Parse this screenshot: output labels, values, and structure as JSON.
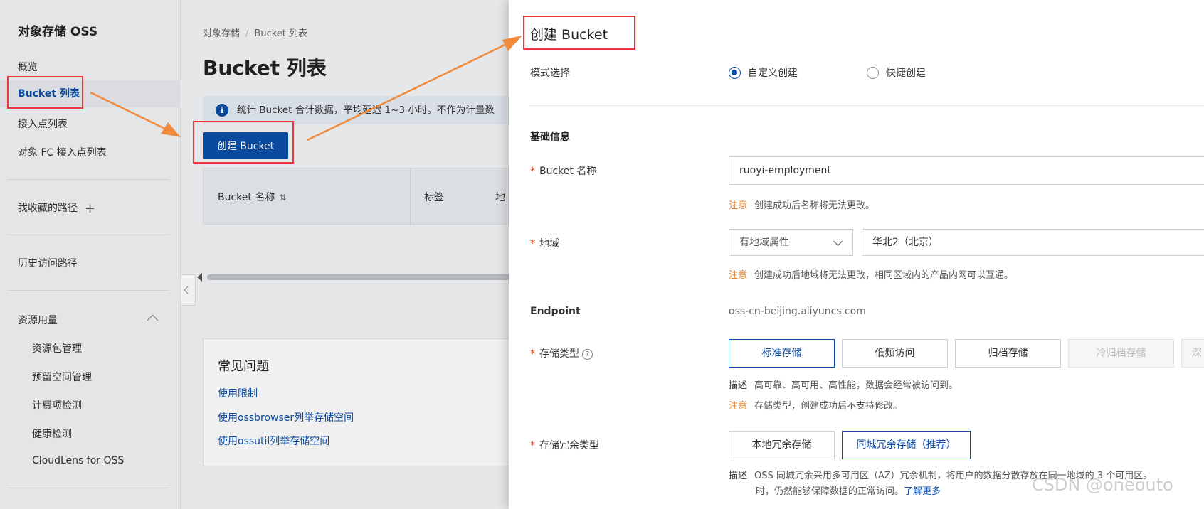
{
  "sidebar": {
    "title": "对象存储 OSS",
    "items": [
      {
        "label": "概览"
      },
      {
        "label": "Bucket 列表"
      },
      {
        "label": "接入点列表"
      },
      {
        "label": "对象 FC 接入点列表"
      }
    ],
    "favorites_label": "我收藏的路径",
    "history_label": "历史访问路径",
    "resource_group": {
      "label": "资源用量",
      "items": [
        {
          "label": "资源包管理"
        },
        {
          "label": "预留空间管理"
        },
        {
          "label": "计费项检测"
        },
        {
          "label": "健康检测"
        },
        {
          "label": "CloudLens for OSS"
        }
      ]
    }
  },
  "main": {
    "breadcrumb": [
      "对象存储",
      "Bucket 列表"
    ],
    "breadcrumb_sep": "/",
    "page_title": "Bucket 列表",
    "info_text": "统计 Bucket 合计数据，平均延迟 1~3 小时。不作为计量数",
    "create_button": "创建 Bucket",
    "table_headers": [
      "Bucket 名称",
      "标签",
      "地"
    ],
    "faq": {
      "title": "常见问题",
      "links": [
        "使用限制",
        "使用ossbrowser列举存储空间",
        "使用ossutil列举存储空间"
      ]
    }
  },
  "drawer": {
    "title": "创建 Bucket",
    "mode": {
      "label": "模式选择",
      "options": [
        "自定义创建",
        "快捷创建"
      ],
      "selected": "自定义创建"
    },
    "basic_section": "基础信息",
    "bucket_name": {
      "label": "Bucket 名称",
      "value": "ruoyi-employment",
      "note_tag": "注意",
      "note": "创建成功后名称将无法更改。"
    },
    "region": {
      "label": "地域",
      "select": "有地域属性",
      "value": "华北2（北京）",
      "note_tag": "注意",
      "note": "创建成功后地域将无法更改，相同区域内的产品内网可以互通。"
    },
    "endpoint": {
      "label": "Endpoint",
      "value": "oss-cn-beijing.aliyuncs.com"
    },
    "storage_class": {
      "label": "存储类型",
      "help": "?",
      "options": [
        "标准存储",
        "低频访问",
        "归档存储",
        "冷归档存储",
        "深"
      ],
      "selected": "标准存储",
      "desc_tag": "描述",
      "desc": "高可靠、高可用、高性能，数据会经常被访问到。",
      "note_tag": "注意",
      "note": "存储类型，创建成功后不支持修改。"
    },
    "redundancy": {
      "label": "存储冗余类型",
      "options": [
        "本地冗余存储",
        "同城冗余存储（推荐）"
      ],
      "selected": "同城冗余存储（推荐）",
      "desc_tag": "描述",
      "desc": "OSS 同城冗余采用多可用区（AZ）冗余机制，将用户的数据分散存放在同一地域的 3 个可用区。",
      "desc2": "时，仍然能够保障数据的正常访问。",
      "link": "了解更多"
    }
  },
  "watermark": "CSDN @oneouto",
  "colors": {
    "brand": "#0b4fa8",
    "highlight": "#e8383d",
    "arrow": "#f08a3c",
    "note": "#e67e22"
  }
}
